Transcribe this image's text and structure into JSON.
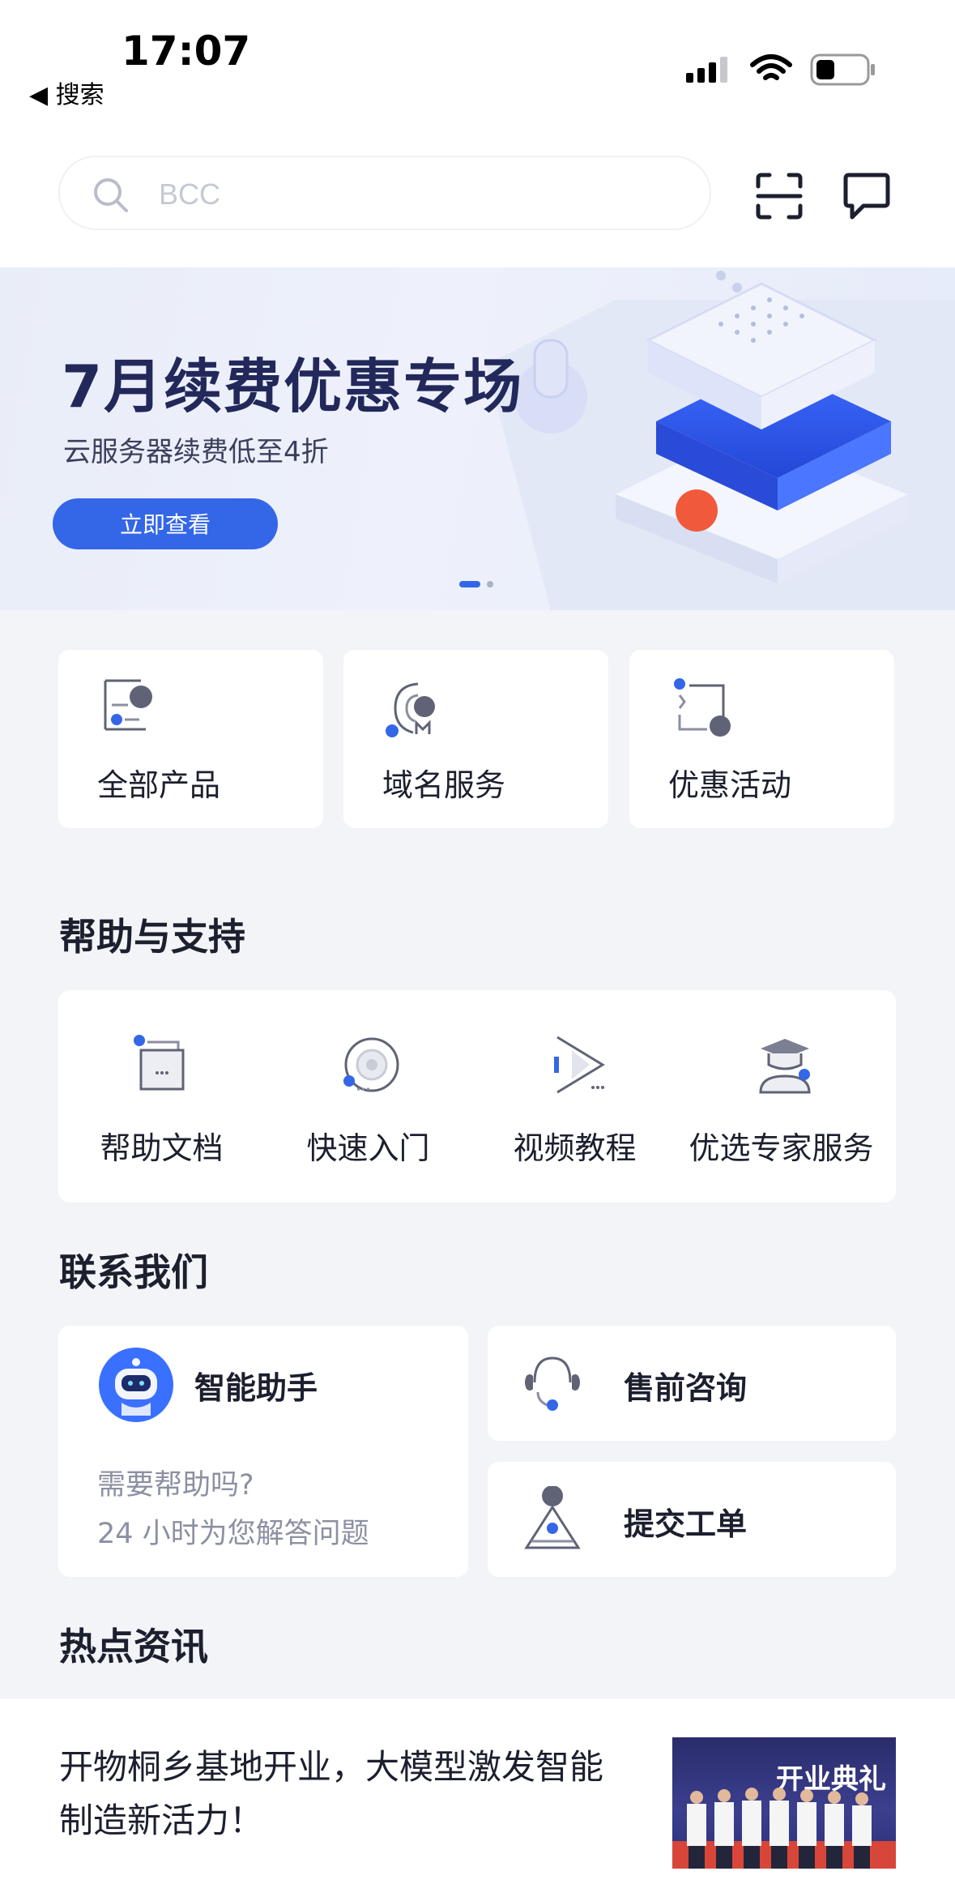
{
  "status_bar": {
    "time": "17:07",
    "back_label": "◀ 搜索"
  },
  "header": {
    "search_placeholder": "BCC"
  },
  "banner": {
    "title": "7月续费优惠专场",
    "subtitle": "云服务器续费低至4折",
    "button_label": "立即查看"
  },
  "quick_links": [
    {
      "label": "全部产品",
      "icon": "all-products-icon"
    },
    {
      "label": "域名服务",
      "icon": "domain-icon"
    },
    {
      "label": "优惠活动",
      "icon": "promo-icon"
    }
  ],
  "help": {
    "title": "帮助与支持",
    "items": [
      {
        "label": "帮助文档",
        "icon": "document-icon"
      },
      {
        "label": "快速入门",
        "icon": "quickstart-icon"
      },
      {
        "label": "视频教程",
        "icon": "video-icon"
      },
      {
        "label": "优选专家服务",
        "icon": "expert-icon"
      }
    ]
  },
  "contact": {
    "title": "联系我们",
    "assistant": {
      "title": "智能助手",
      "line1": "需要帮助吗?",
      "line2": "24 小时为您解答问题"
    },
    "presale": "售前咨询",
    "ticket": "提交工单"
  },
  "news": {
    "title": "热点资讯",
    "items": [
      {
        "headline": "开物桐乡基地开业，大模型激发智能制造新活力！",
        "image_banner": "开业典礼"
      }
    ]
  },
  "colors": {
    "accent": "#3466e8",
    "icon_gray": "#5f6375",
    "background": "#f3f4f8"
  }
}
